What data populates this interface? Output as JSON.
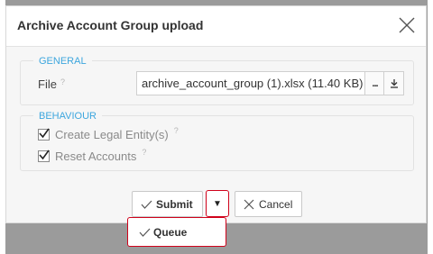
{
  "dialog": {
    "title": "Archive Account Group upload",
    "close_icon": "close-icon"
  },
  "general": {
    "legend": "GENERAL",
    "file_label": "File",
    "help_mark": "?",
    "file_value": "archive_account_group (1).xlsx (11.40 KB)",
    "browse_label": "...",
    "download_icon": "download-icon"
  },
  "behaviour": {
    "legend": "BEHAVIOUR",
    "options": [
      {
        "label": "Create Legal Entity(s)",
        "checked": true,
        "help_mark": "?"
      },
      {
        "label": "Reset Accounts",
        "checked": true,
        "help_mark": "?"
      }
    ]
  },
  "footer": {
    "submit_label": "Submit",
    "caret": "▼",
    "cancel_label": "Cancel",
    "menu": {
      "queue_label": "Queue"
    }
  },
  "colors": {
    "accent": "#3da6de",
    "highlight": "#d0021b"
  }
}
